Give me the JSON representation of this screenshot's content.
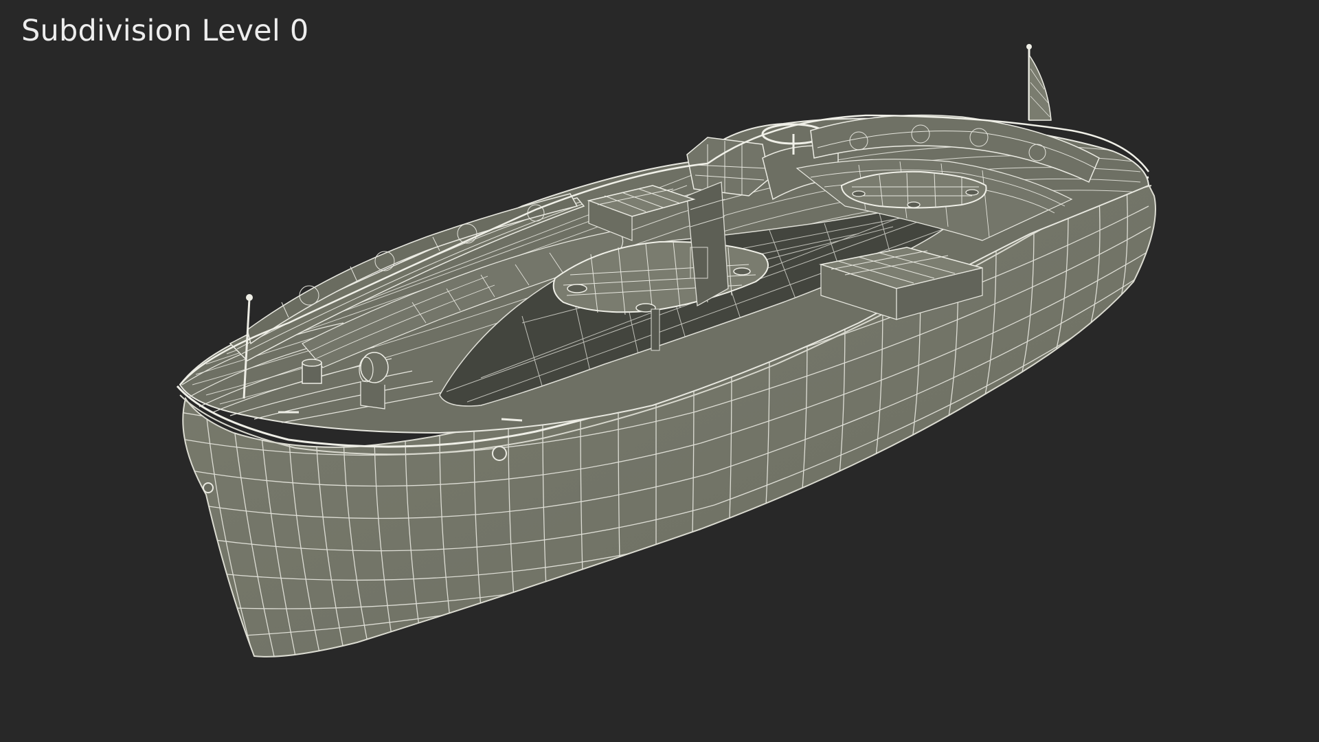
{
  "viewport": {
    "title": "Subdivision Level 0",
    "object": "boat-wireframe-render",
    "colors": {
      "background": "#282828",
      "hull": "#76786a",
      "deck": "#6b6d60",
      "interior": "#4a4c44",
      "wire": "#e9e9e1",
      "title_text": "#ededed"
    }
  }
}
